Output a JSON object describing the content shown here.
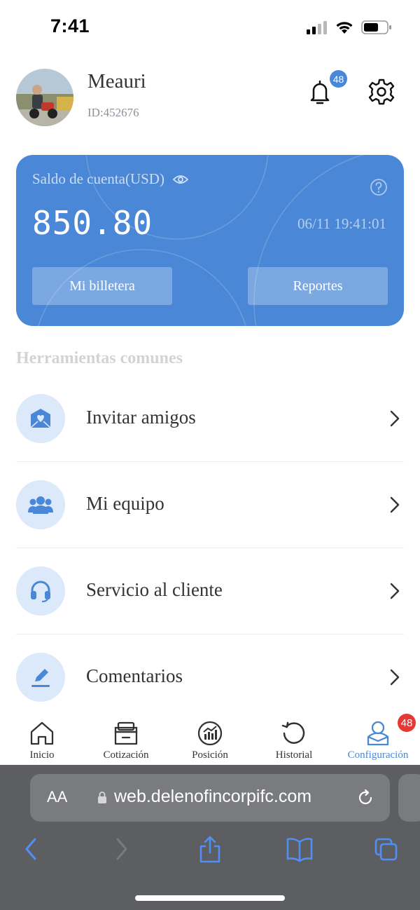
{
  "status_bar": {
    "time": "7:41"
  },
  "profile": {
    "name": "Meauri",
    "id_text": "ID:452676",
    "notification_count": "48"
  },
  "balance_card": {
    "label": "Saldo de cuenta(USD)",
    "amount": "850.80",
    "datetime": "06/11 19:41:01",
    "wallet_button": "Mi billetera",
    "reports_button": "Reportes",
    "color": "#4a87d6"
  },
  "tools": {
    "title": "Herramientas comunes",
    "items": [
      {
        "label": "Invitar amigos",
        "icon": "invite-icon"
      },
      {
        "label": "Mi equipo",
        "icon": "team-icon"
      },
      {
        "label": "Servicio al cliente",
        "icon": "headset-icon"
      },
      {
        "label": "Comentarios",
        "icon": "pencil-icon"
      }
    ]
  },
  "tabbar": {
    "items": [
      {
        "label": "Inicio",
        "icon": "home-icon",
        "active": false
      },
      {
        "label": "Cotización",
        "icon": "quote-icon",
        "active": false
      },
      {
        "label": "Posición",
        "icon": "position-icon",
        "active": false
      },
      {
        "label": "Historial",
        "icon": "history-icon",
        "active": false
      },
      {
        "label": "Configuración",
        "icon": "profile-icon",
        "active": true,
        "badge": "48"
      }
    ],
    "active_color": "#4a87d6",
    "badge_color": "#e53935"
  },
  "browser": {
    "text_size_label": "AA",
    "url": "web.delenofincorpifc.com"
  }
}
